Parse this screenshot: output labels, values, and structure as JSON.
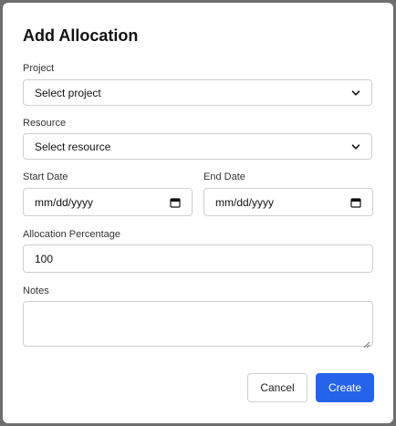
{
  "dialog": {
    "title": "Add Allocation"
  },
  "fields": {
    "project": {
      "label": "Project",
      "value": "Select project"
    },
    "resource": {
      "label": "Resource",
      "value": "Select resource"
    },
    "start_date": {
      "label": "Start Date",
      "value": "mm/dd/yyyy"
    },
    "end_date": {
      "label": "End Date",
      "value": "mm/dd/yyyy"
    },
    "allocation_percentage": {
      "label": "Allocation Percentage",
      "value": "100"
    },
    "notes": {
      "label": "Notes",
      "value": ""
    }
  },
  "actions": {
    "cancel_label": "Cancel",
    "create_label": "Create"
  },
  "colors": {
    "primary": "#2563eb",
    "overlay": "#6e6e6e",
    "border": "#cfcfcf"
  },
  "icons": {
    "select_caret": "chevron-down-icon",
    "date_picker": "calendar-icon",
    "textarea_resize": "resize-handle-icon"
  }
}
